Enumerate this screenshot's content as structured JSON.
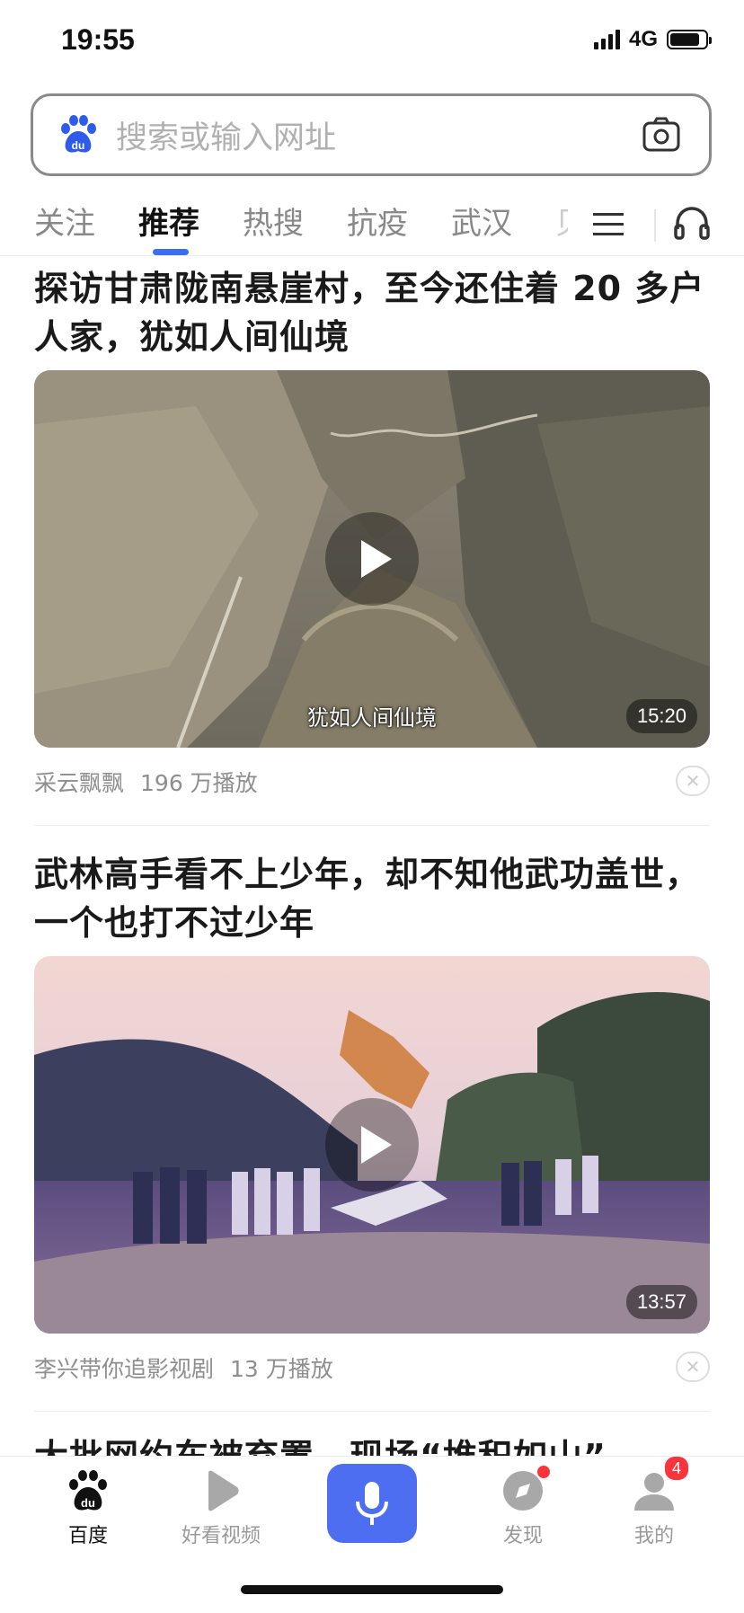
{
  "status_bar": {
    "time": "19:55",
    "network": "4G",
    "battery_level": 0.85
  },
  "search": {
    "placeholder": "搜索或输入网址"
  },
  "tabs": [
    {
      "label": "关注",
      "active": false
    },
    {
      "label": "推荐",
      "active": true
    },
    {
      "label": "热搜",
      "active": false
    },
    {
      "label": "抗疫",
      "active": false
    },
    {
      "label": "武汉",
      "active": false
    },
    {
      "label": "贝",
      "active": false
    }
  ],
  "feed": [
    {
      "title": "探访甘肃陇南悬崖村，至今还住着 20 多户人家，犹如人间仙境",
      "subtitle": "犹如人间仙境",
      "duration": "15:20",
      "author": "采云飘飘",
      "views": "196 万播放"
    },
    {
      "title": "武林高手看不上少年，却不知他武功盖世，一个也打不过少年",
      "subtitle": "",
      "duration": "13:57",
      "author": "李兴带你追影视剧",
      "views": "13 万播放"
    }
  ],
  "next_title": "大批网约车被弃置，现场“堆积如山”",
  "bottom_nav": {
    "home": "百度",
    "video": "好看视频",
    "discover": "发现",
    "mine": "我的",
    "mine_badge": "4"
  },
  "colors": {
    "accent": "#4e6ef2",
    "tab_indicator": "#3a6cf4",
    "badge": "#f7353a"
  }
}
